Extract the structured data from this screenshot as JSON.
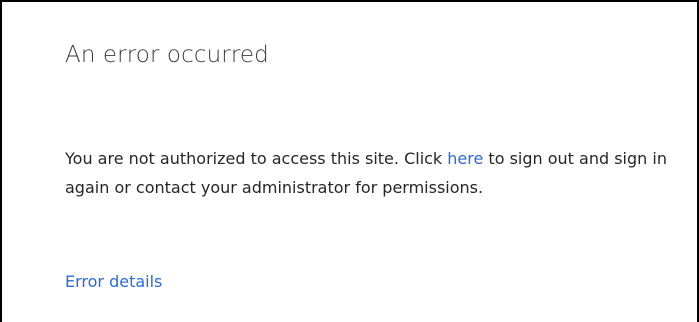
{
  "error_panel": {
    "title": "An error occurred",
    "message": {
      "before_link": "You are not authorized to access this site. Click ",
      "link_text": "here",
      "after_link": " to sign out and sign in again or contact your administrator for permissions."
    },
    "details_link": "Error details"
  },
  "colors": {
    "link": "#2a6bd9",
    "title_text": "#3b3b3b",
    "body_text": "#262626",
    "border": "#000000"
  }
}
